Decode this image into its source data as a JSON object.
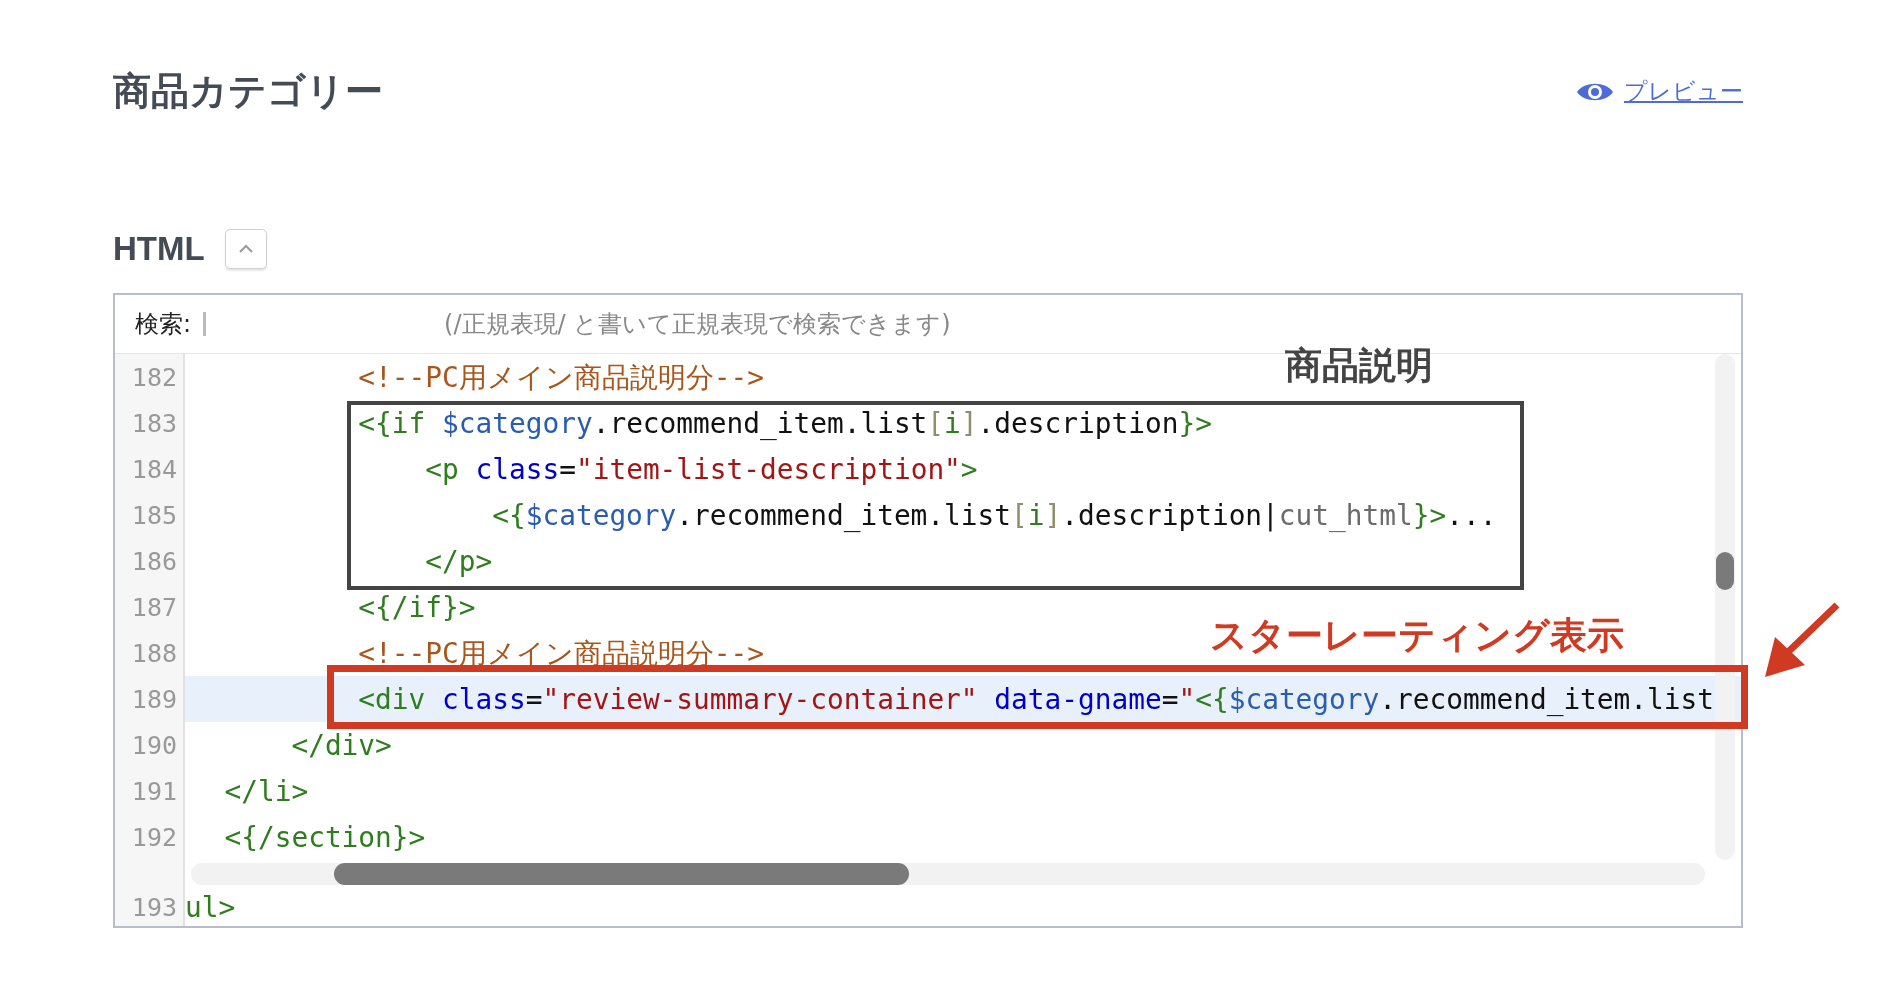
{
  "page": {
    "title": "商品カテゴリー",
    "preview_link": "プレビュー"
  },
  "section": {
    "heading": "HTML",
    "expanded": true
  },
  "editor": {
    "search": {
      "label": "検索:",
      "placeholder": "(/正規表現/ と書いて正規表現で検索できます)"
    },
    "lines": [
      {
        "number": "182",
        "selected": false,
        "tokens": [
          {
            "kind": "comment",
            "text": "          <!--PC用メイン商品説明分-->"
          }
        ]
      },
      {
        "number": "183",
        "selected": false,
        "tokens": [
          {
            "kind": "tag",
            "text": "          <{if "
          },
          {
            "kind": "var",
            "text": "$category"
          },
          {
            "kind": "plain",
            "text": ".recommend_item.list"
          },
          {
            "kind": "bracket",
            "text": "["
          },
          {
            "kind": "tag",
            "text": "i"
          },
          {
            "kind": "bracket",
            "text": "]"
          },
          {
            "kind": "plain",
            "text": ".description"
          },
          {
            "kind": "tag",
            "text": "}>"
          }
        ]
      },
      {
        "number": "184",
        "selected": false,
        "tokens": [
          {
            "kind": "tag",
            "text": "              <p "
          },
          {
            "kind": "attr",
            "text": "class"
          },
          {
            "kind": "plain",
            "text": "="
          },
          {
            "kind": "string",
            "text": "\"item-list-description\""
          },
          {
            "kind": "tag",
            "text": ">"
          }
        ]
      },
      {
        "number": "185",
        "selected": false,
        "tokens": [
          {
            "kind": "tag",
            "text": "                  <{"
          },
          {
            "kind": "var",
            "text": "$category"
          },
          {
            "kind": "plain",
            "text": ".recommend_item.list"
          },
          {
            "kind": "bracket",
            "text": "["
          },
          {
            "kind": "tag",
            "text": "i"
          },
          {
            "kind": "bracket",
            "text": "]"
          },
          {
            "kind": "plain",
            "text": ".description|"
          },
          {
            "kind": "modifier",
            "text": "cut_html"
          },
          {
            "kind": "tag",
            "text": "}>"
          },
          {
            "kind": "plain",
            "text": "..."
          }
        ]
      },
      {
        "number": "186",
        "selected": false,
        "tokens": [
          {
            "kind": "tag",
            "text": "              </p>"
          }
        ]
      },
      {
        "number": "187",
        "selected": false,
        "tokens": [
          {
            "kind": "tag",
            "text": "          <{/if}>"
          }
        ]
      },
      {
        "number": "188",
        "selected": false,
        "tokens": [
          {
            "kind": "comment",
            "text": "          <!--PC用メイン商品説明分-->"
          }
        ]
      },
      {
        "number": "189",
        "selected": true,
        "tokens": [
          {
            "kind": "tag",
            "text": "          <div "
          },
          {
            "kind": "attr",
            "text": "class"
          },
          {
            "kind": "plain",
            "text": "="
          },
          {
            "kind": "string",
            "text": "\"review-summary-container\""
          },
          {
            "kind": "attr",
            "text": " data-gname"
          },
          {
            "kind": "plain",
            "text": "="
          },
          {
            "kind": "string",
            "text": "\""
          },
          {
            "kind": "tag",
            "text": "<{"
          },
          {
            "kind": "var",
            "text": "$category"
          },
          {
            "kind": "plain",
            "text": ".recommend_item.list"
          }
        ]
      },
      {
        "number": "190",
        "selected": false,
        "tokens": [
          {
            "kind": "tag",
            "text": "      </div>"
          }
        ]
      },
      {
        "number": "191",
        "selected": false,
        "tokens": [
          {
            "kind": "tag",
            "text": "  </li>"
          }
        ]
      },
      {
        "number": "192",
        "selected": false,
        "tokens": [
          {
            "kind": "tag",
            "text": "  <{/section}>"
          }
        ]
      },
      {
        "number": "193",
        "selected": false,
        "tokens": [
          {
            "kind": "tag",
            "text": "ul>"
          }
        ]
      }
    ]
  },
  "annotations": [
    {
      "kind": "box",
      "label": "商品説明",
      "color": "#444444"
    },
    {
      "kind": "arrow-box",
      "label": "スターレーティング表示",
      "color": "#d03a22"
    }
  ]
}
